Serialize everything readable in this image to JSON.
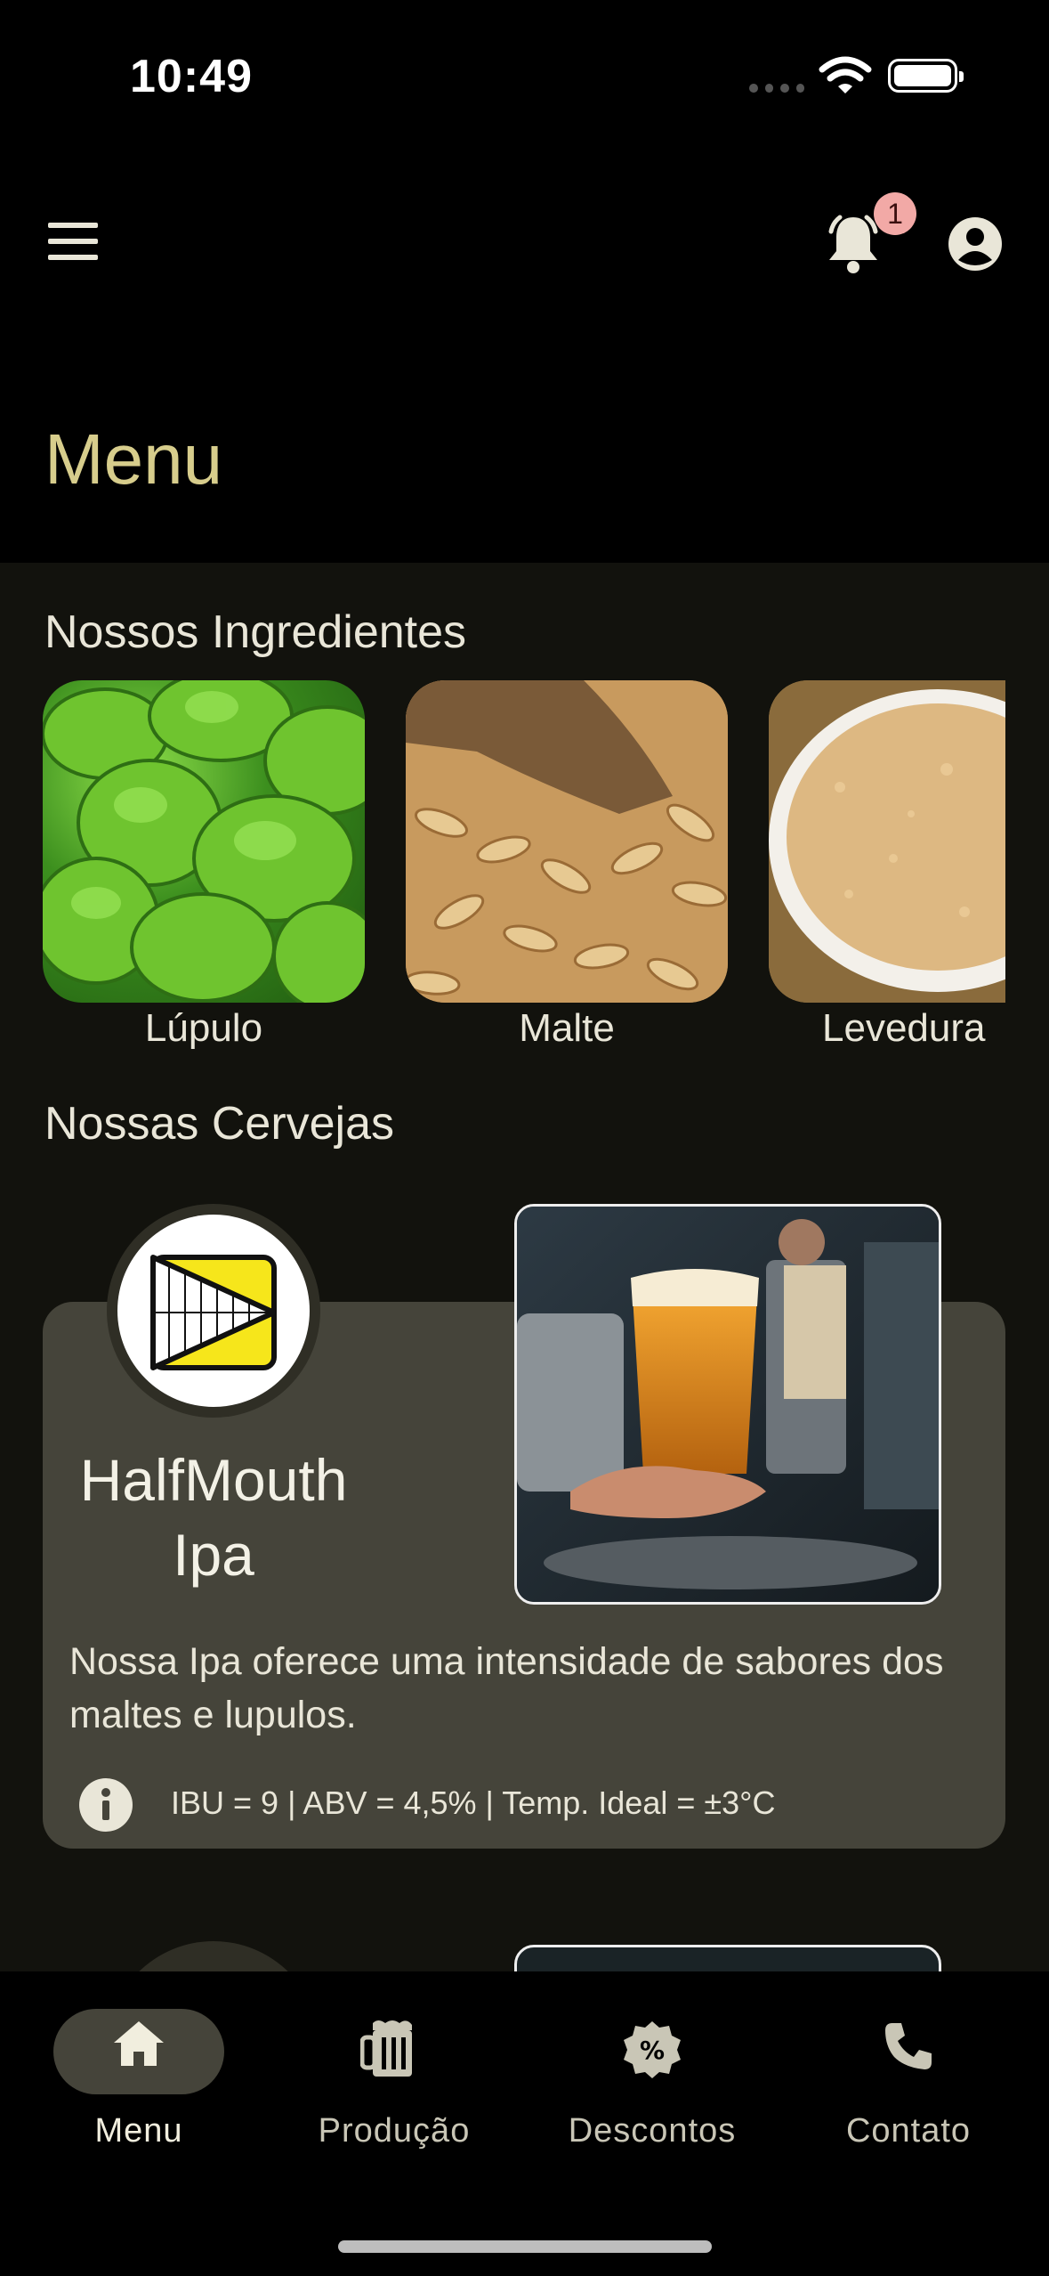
{
  "status_bar": {
    "time": "10:49"
  },
  "header": {
    "notification_count": "1",
    "title": "Menu"
  },
  "ingredients": {
    "title": "Nossos Ingredientes",
    "items": [
      {
        "label": "Lúpulo"
      },
      {
        "label": "Malte"
      },
      {
        "label": "Levedura"
      }
    ]
  },
  "beers": {
    "title": "Nossas Cervejas",
    "items": [
      {
        "name_line1": "HalfMouth",
        "name_line2": "Ipa",
        "description": "Nossa Ipa oferece uma intensidade de sabores dos maltes e lupulos.",
        "stats": "IBU = 9 | ABV = 4,5% | Temp. Ideal = ±3°C"
      }
    ]
  },
  "bottom_nav": {
    "items": [
      {
        "label": "Menu",
        "icon": "home-icon",
        "active": true
      },
      {
        "label": "Produção",
        "icon": "beer-mug-icon"
      },
      {
        "label": "Descontos",
        "icon": "discount-icon"
      },
      {
        "label": "Contato",
        "icon": "phone-icon"
      }
    ]
  },
  "colors": {
    "background": "#12120d",
    "topbar": "#000000",
    "title_accent": "#d7cd8c",
    "card": "#45443a",
    "badge": "#f2a9a6",
    "logo_yellow": "#f6e61b"
  }
}
